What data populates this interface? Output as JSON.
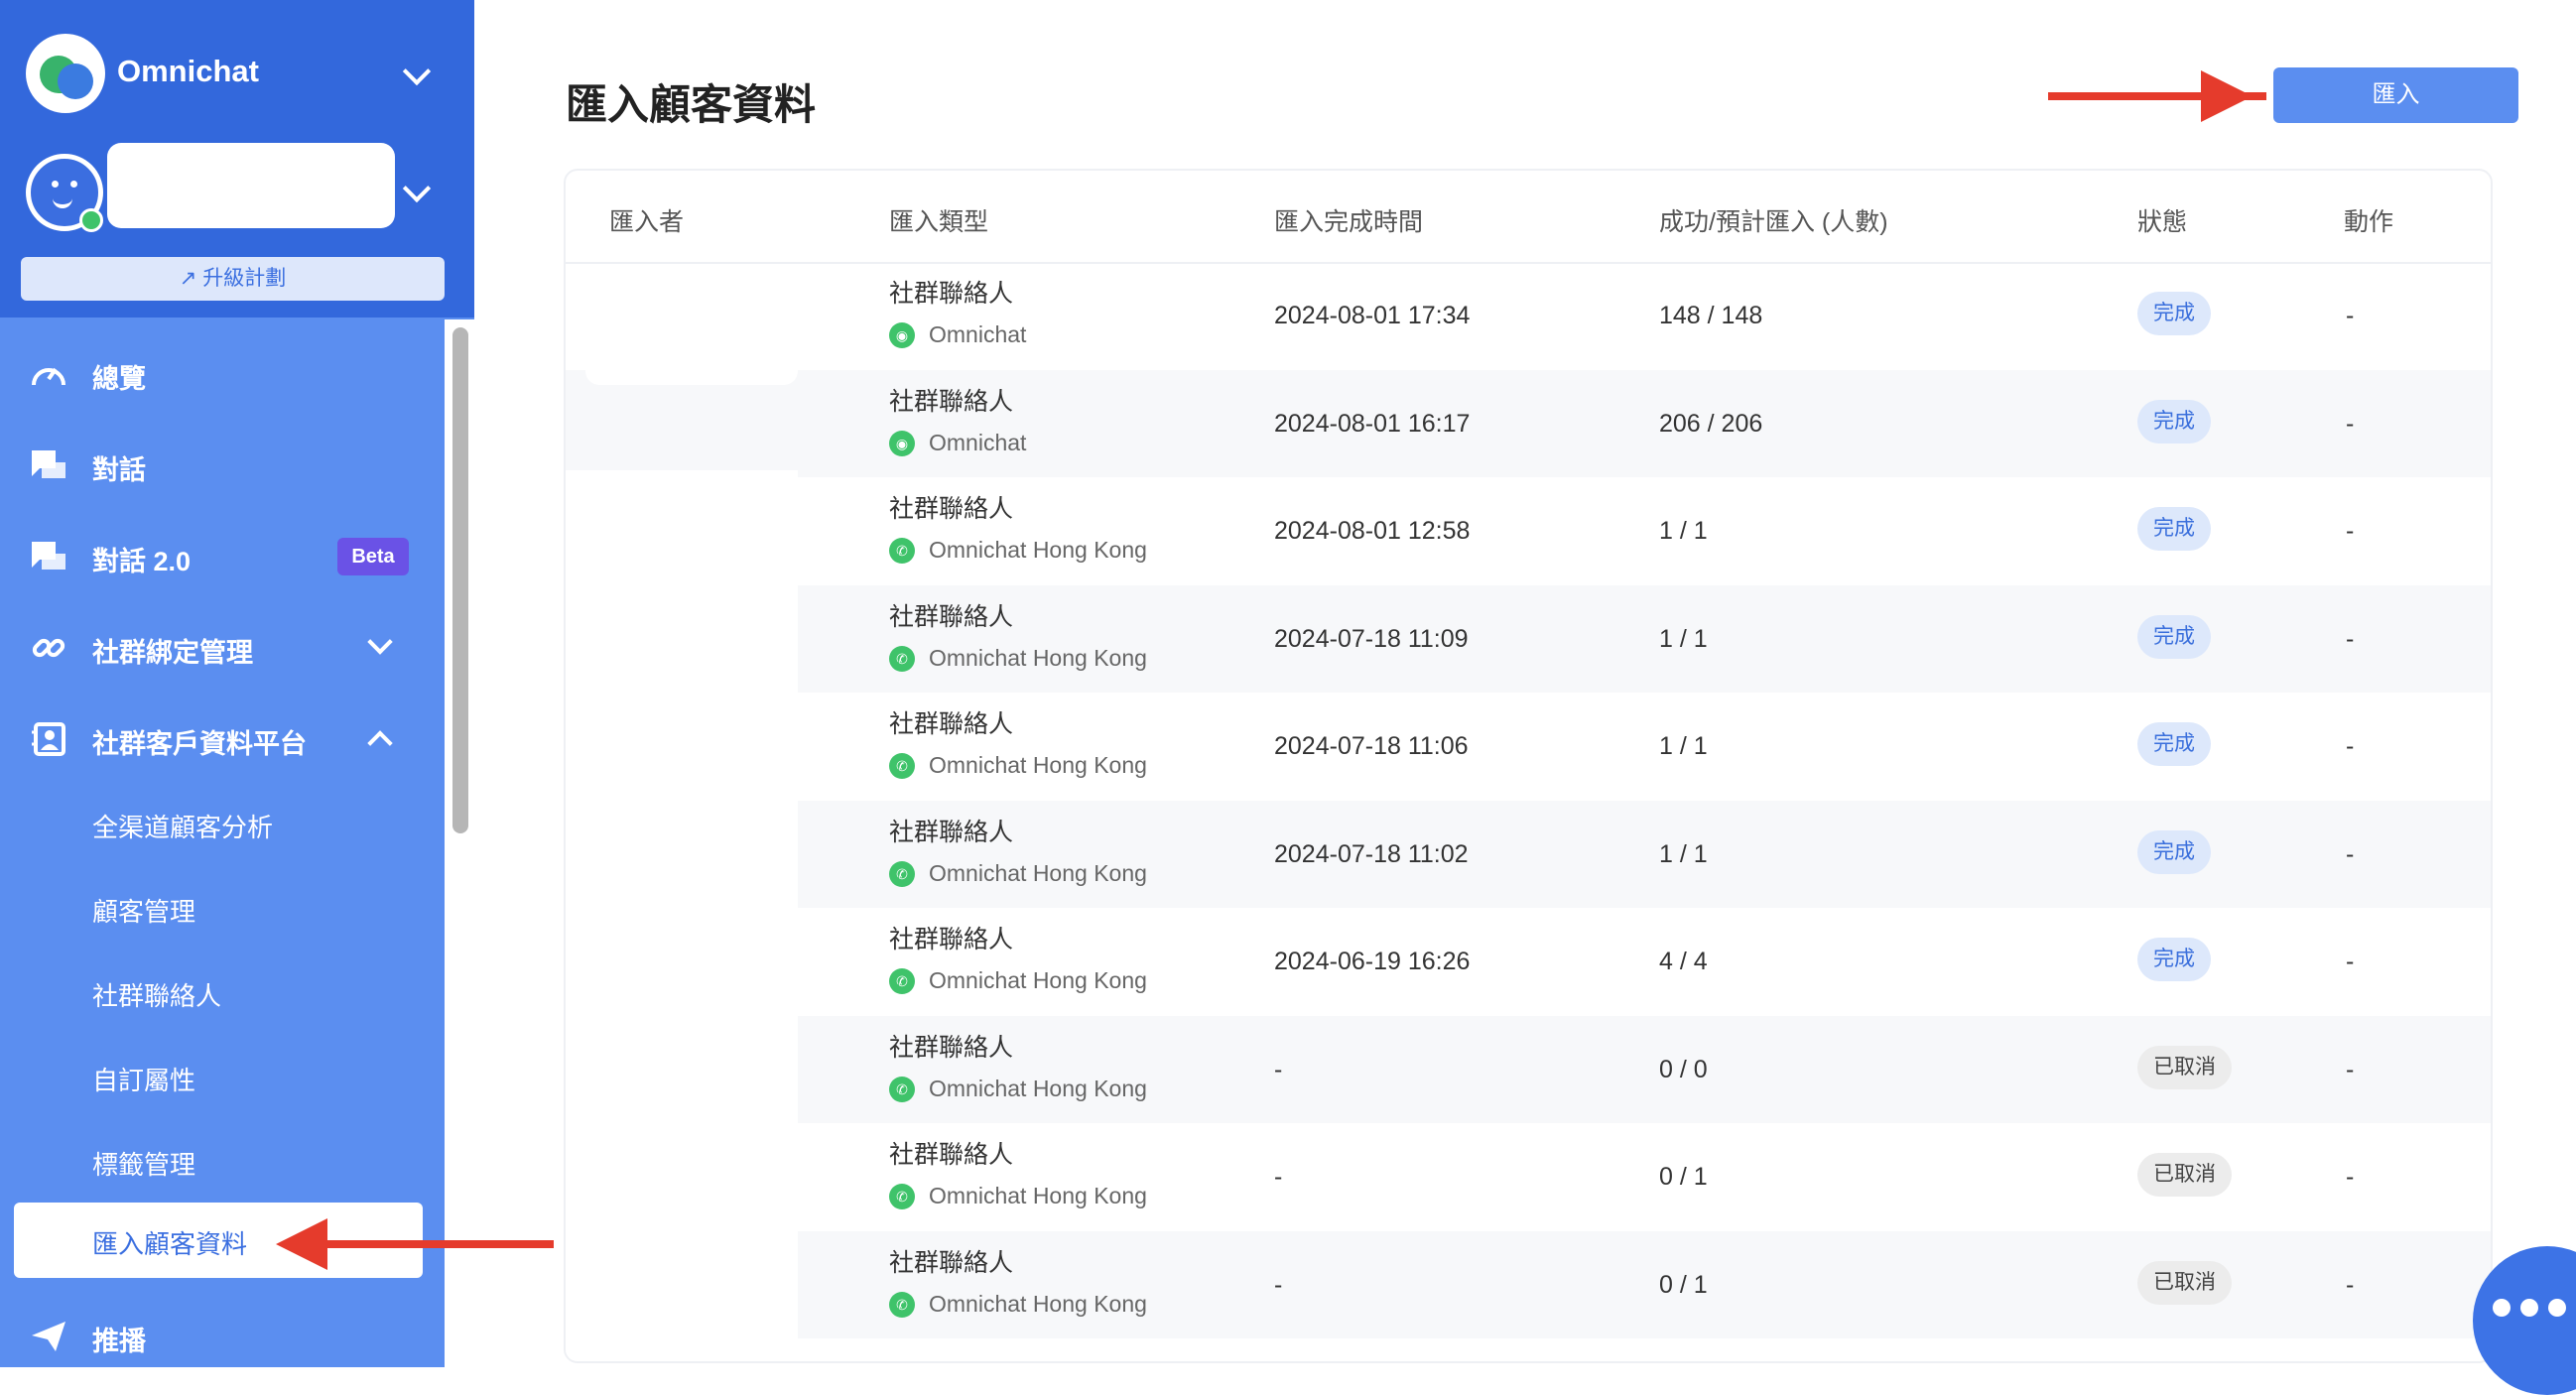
{
  "sidebar": {
    "brand": "Omnichat",
    "upgrade_label": "↗ 升級計劃",
    "items": [
      {
        "label": "總覽",
        "icon": "dashboard-icon"
      },
      {
        "label": "對話",
        "icon": "chat-icon"
      },
      {
        "label": "對話 2.0",
        "icon": "chat-icon",
        "badge": "Beta"
      },
      {
        "label": "社群綁定管理",
        "icon": "link-icon"
      },
      {
        "label": "社群客戶資料平台",
        "icon": "contacts-icon"
      }
    ],
    "sub_items": [
      {
        "label": "全渠道顧客分析"
      },
      {
        "label": "顧客管理"
      },
      {
        "label": "社群聯絡人"
      },
      {
        "label": "自訂屬性"
      },
      {
        "label": "標籤管理"
      },
      {
        "label": "匯入顧客資料",
        "active": true
      }
    ],
    "last_item": {
      "label": "推播",
      "icon": "send-icon"
    }
  },
  "main": {
    "title": "匯入顧客資料",
    "import_button": "匯入",
    "columns": [
      "匯入者",
      "匯入類型",
      "匯入完成時間",
      "成功/預計匯入 (人數)",
      "狀態",
      "動作"
    ],
    "rows": [
      {
        "type": "社群聯絡人",
        "channel": "Omnichat",
        "channel_kind": "line",
        "time": "2024-08-01 17:34",
        "count": "148 / 148",
        "status": "完成",
        "status_kind": "done",
        "action": "-"
      },
      {
        "type": "社群聯絡人",
        "channel": "Omnichat",
        "channel_kind": "line",
        "time": "2024-08-01 16:17",
        "count": "206 / 206",
        "status": "完成",
        "status_kind": "done",
        "action": "-"
      },
      {
        "type": "社群聯絡人",
        "channel": "Omnichat Hong Kong",
        "channel_kind": "whatsapp",
        "time": "2024-08-01 12:58",
        "count": "1 / 1",
        "status": "完成",
        "status_kind": "done",
        "action": "-"
      },
      {
        "type": "社群聯絡人",
        "channel": "Omnichat Hong Kong",
        "channel_kind": "whatsapp",
        "time": "2024-07-18 11:09",
        "count": "1 / 1",
        "status": "完成",
        "status_kind": "done",
        "action": "-"
      },
      {
        "type": "社群聯絡人",
        "channel": "Omnichat Hong Kong",
        "channel_kind": "whatsapp",
        "time": "2024-07-18 11:06",
        "count": "1 / 1",
        "status": "完成",
        "status_kind": "done",
        "action": "-"
      },
      {
        "type": "社群聯絡人",
        "channel": "Omnichat Hong Kong",
        "channel_kind": "whatsapp",
        "time": "2024-07-18 11:02",
        "count": "1 / 1",
        "status": "完成",
        "status_kind": "done",
        "action": "-"
      },
      {
        "type": "社群聯絡人",
        "channel": "Omnichat Hong Kong",
        "channel_kind": "whatsapp",
        "time": "2024-06-19 16:26",
        "count": "4 / 4",
        "status": "完成",
        "status_kind": "done",
        "action": "-"
      },
      {
        "type": "社群聯絡人",
        "channel": "Omnichat Hong Kong",
        "channel_kind": "whatsapp",
        "time": "-",
        "count": "0 / 0",
        "status": "已取消",
        "status_kind": "cancel",
        "action": "-"
      },
      {
        "type": "社群聯絡人",
        "channel": "Omnichat Hong Kong",
        "channel_kind": "whatsapp",
        "time": "-",
        "count": "0 / 1",
        "status": "已取消",
        "status_kind": "cancel",
        "action": "-"
      },
      {
        "type": "社群聯絡人",
        "channel": "Omnichat Hong Kong",
        "channel_kind": "whatsapp",
        "time": "-",
        "count": "0 / 1",
        "status": "已取消",
        "status_kind": "cancel",
        "action": "-"
      }
    ]
  },
  "colors": {
    "sidebar_top": "#3368dc",
    "sidebar": "#5b8ef0",
    "accent": "#5b8ef0",
    "arrow": "#e53b2c",
    "beta": "#6a52e6"
  }
}
